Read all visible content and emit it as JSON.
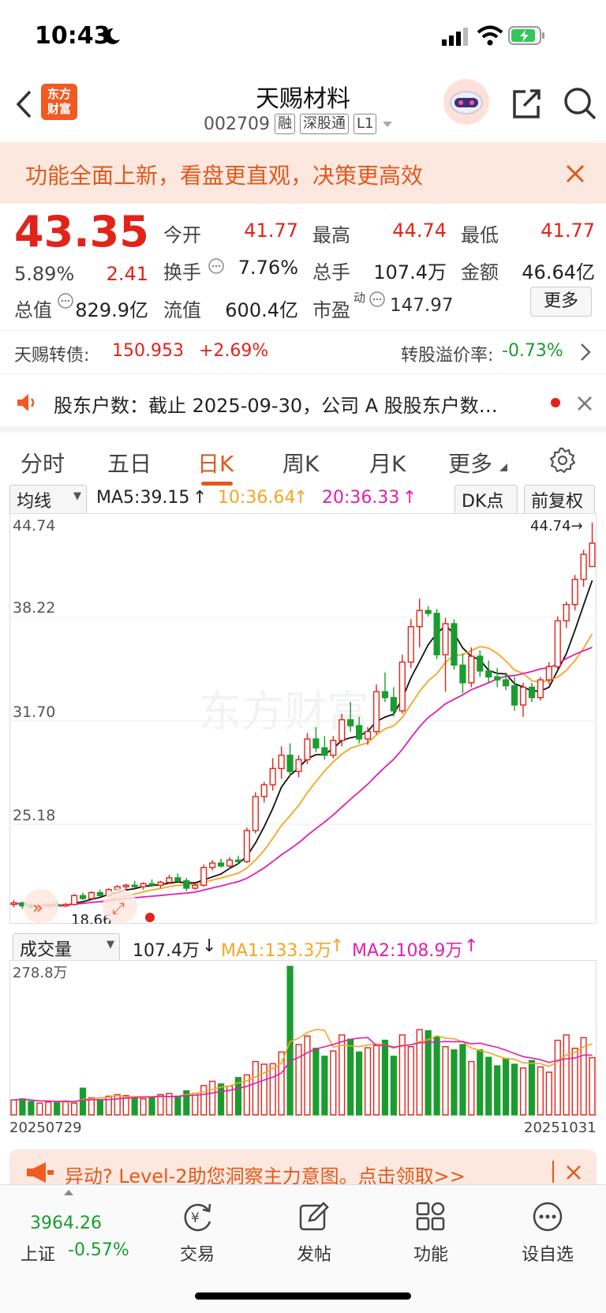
{
  "status_bar": {
    "time": "10:43"
  },
  "header": {
    "logo_text_1": "东方",
    "logo_text_2": "财富",
    "title": "天赐材料",
    "code": "002709",
    "tags": [
      "融",
      "深股通",
      "L1"
    ]
  },
  "banner": {
    "text": "功能全面上新，看盘更直观，决策更高效"
  },
  "quote": {
    "price": "43.35",
    "change_pct": "5.89%",
    "change": "2.41",
    "open_label": "今开",
    "open": "41.77",
    "high_label": "最高",
    "high": "44.74",
    "low_label": "最低",
    "low": "41.77",
    "turnover_label": "换手",
    "turnover": "7.76%",
    "volume_label": "总手",
    "volume": "107.4万",
    "amount_label": "金额",
    "amount": "46.64亿",
    "mktcap_label": "总值",
    "mktcap": "829.9亿",
    "float_label": "流值",
    "float": "600.4亿",
    "pe_label": "市盈",
    "pe_sup": "动",
    "pe": "147.97",
    "more_label": "更多"
  },
  "convertible": {
    "label": "天赐转债:",
    "price": "150.953",
    "change": "+2.69%",
    "premium_label": "转股溢价率:",
    "premium": "-0.73%"
  },
  "notice": {
    "text": "股东户数：截止 2025-09-30，公司 A 股股东户数…"
  },
  "tabs": [
    "分时",
    "五日",
    "日K",
    "周K",
    "月K",
    "更多"
  ],
  "ma_row": {
    "select": "均线",
    "ma5": "MA5:39.15",
    "ma10": "10:36.64",
    "ma20": "20:36.33",
    "dk_label": "DK点",
    "adjust_label": "前复权"
  },
  "kline": {
    "y_labels": [
      "44.74",
      "38.22",
      "31.70",
      "25.18"
    ],
    "high_marker": "44.74",
    "low_marker": "18.66",
    "watermark": "东方财富"
  },
  "vol_row": {
    "select": "成交量",
    "vol": "107.4万",
    "ma1": "MA1:133.3万",
    "ma2": "MA2:108.9万",
    "max_label": "278.8万",
    "date_start": "20250729",
    "date_end": "20251031"
  },
  "promo": {
    "text": "异动? Level-2助您洞察主力意图。点击领取>>"
  },
  "tabbar": {
    "index_value": "3964.26",
    "index_name": "上证",
    "index_change": "-0.57%",
    "items": [
      "交易",
      "发帖",
      "功能",
      "设自选"
    ]
  },
  "colors": {
    "up": "#e2231a",
    "down": "#1a9c2e",
    "accent": "#e05a1e",
    "ma10": "#f5a623",
    "ma20": "#e020b0"
  },
  "chart_data": {
    "type": "candlestick",
    "candles": [
      [
        18.9,
        19.2,
        18.7,
        19.0
      ],
      [
        19.0,
        19.1,
        18.6,
        18.8
      ],
      [
        18.8,
        19.0,
        18.6,
        18.7
      ],
      [
        18.7,
        18.9,
        18.66,
        18.8
      ],
      [
        18.8,
        19.0,
        18.7,
        18.9
      ],
      [
        18.9,
        19.1,
        18.7,
        18.8
      ],
      [
        18.8,
        19.0,
        18.7,
        18.9
      ],
      [
        18.9,
        19.6,
        18.8,
        19.5
      ],
      [
        19.5,
        19.7,
        19.2,
        19.3
      ],
      [
        19.3,
        19.8,
        19.2,
        19.7
      ],
      [
        19.7,
        19.9,
        19.4,
        19.5
      ],
      [
        19.5,
        20.0,
        19.4,
        19.9
      ],
      [
        19.9,
        20.2,
        19.7,
        20.1
      ],
      [
        20.1,
        20.3,
        19.9,
        20.2
      ],
      [
        20.2,
        20.5,
        20.0,
        20.1
      ],
      [
        20.1,
        20.4,
        19.9,
        20.3
      ],
      [
        20.3,
        20.6,
        20.1,
        20.2
      ],
      [
        20.2,
        20.5,
        20.0,
        20.4
      ],
      [
        20.4,
        20.9,
        20.3,
        20.7
      ],
      [
        20.7,
        21.0,
        20.4,
        20.5
      ],
      [
        20.5,
        20.7,
        19.8,
        20.0
      ],
      [
        20.0,
        20.3,
        19.9,
        20.2
      ],
      [
        20.2,
        21.6,
        20.1,
        21.4
      ],
      [
        21.4,
        21.9,
        21.2,
        21.7
      ],
      [
        21.7,
        22.0,
        21.4,
        21.5
      ],
      [
        21.5,
        22.1,
        21.3,
        21.9
      ],
      [
        21.9,
        22.2,
        21.6,
        21.8
      ],
      [
        21.8,
        24.1,
        21.7,
        23.9
      ],
      [
        23.9,
        26.5,
        23.7,
        26.2
      ],
      [
        26.2,
        27.2,
        25.8,
        27.0
      ],
      [
        27.0,
        28.8,
        26.6,
        28.1
      ],
      [
        28.1,
        29.6,
        27.4,
        29.0
      ],
      [
        29.0,
        29.8,
        27.6,
        27.9
      ],
      [
        27.9,
        29.0,
        27.5,
        28.7
      ],
      [
        28.7,
        30.5,
        28.4,
        30.1
      ],
      [
        30.1,
        30.9,
        29.2,
        29.5
      ],
      [
        29.5,
        30.3,
        28.7,
        29.0
      ],
      [
        29.0,
        30.3,
        28.8,
        30.0
      ],
      [
        30.0,
        31.8,
        29.6,
        31.4
      ],
      [
        31.4,
        32.6,
        30.6,
        31.0
      ],
      [
        31.0,
        31.6,
        29.8,
        30.1
      ],
      [
        30.1,
        30.9,
        29.7,
        30.6
      ],
      [
        30.6,
        33.8,
        30.4,
        33.3
      ],
      [
        33.3,
        34.6,
        32.6,
        32.9
      ],
      [
        32.9,
        33.6,
        31.6,
        32.0
      ],
      [
        32.0,
        35.8,
        31.8,
        35.3
      ],
      [
        35.3,
        38.2,
        34.9,
        37.7
      ],
      [
        37.7,
        39.6,
        36.3,
        38.8
      ],
      [
        38.8,
        39.1,
        38.4,
        38.6
      ],
      [
        38.6,
        38.9,
        35.5,
        35.8
      ],
      [
        35.8,
        38.3,
        33.3,
        37.9
      ],
      [
        37.9,
        38.2,
        34.8,
        35.1
      ],
      [
        35.1,
        35.9,
        33.2,
        33.9
      ],
      [
        33.9,
        36.3,
        33.6,
        35.7
      ],
      [
        35.7,
        36.1,
        34.3,
        34.7
      ],
      [
        34.7,
        35.4,
        33.9,
        34.3
      ],
      [
        34.3,
        34.9,
        33.6,
        34.1
      ],
      [
        34.1,
        34.6,
        33.4,
        33.7
      ],
      [
        33.7,
        34.3,
        32.0,
        32.4
      ],
      [
        32.4,
        33.9,
        31.6,
        33.6
      ],
      [
        33.6,
        33.9,
        32.6,
        32.9
      ],
      [
        32.9,
        34.3,
        32.7,
        34.1
      ],
      [
        34.1,
        35.3,
        33.8,
        35.0
      ],
      [
        35.0,
        38.4,
        34.8,
        38.1
      ],
      [
        38.1,
        39.4,
        37.6,
        39.2
      ],
      [
        39.2,
        41.2,
        38.8,
        40.9
      ],
      [
        40.9,
        42.9,
        40.4,
        42.6
      ],
      [
        41.77,
        44.74,
        41.77,
        43.35
      ]
    ],
    "volume_wan": [
      28,
      30,
      25,
      22,
      24,
      23,
      26,
      22,
      50,
      32,
      28,
      35,
      38,
      36,
      33,
      30,
      32,
      38,
      40,
      35,
      45,
      40,
      55,
      63,
      58,
      54,
      70,
      75,
      100,
      95,
      96,
      118,
      278.8,
      132,
      148,
      125,
      110,
      120,
      150,
      142,
      118,
      126,
      130,
      140,
      110,
      150,
      128,
      160,
      158,
      146,
      128,
      122,
      132,
      100,
      122,
      108,
      92,
      106,
      95,
      88,
      102,
      90,
      80,
      140,
      150,
      125,
      145,
      107.4
    ],
    "ylim": [
      18.66,
      44.74
    ],
    "x_start": "20250729",
    "x_end": "20251031"
  }
}
